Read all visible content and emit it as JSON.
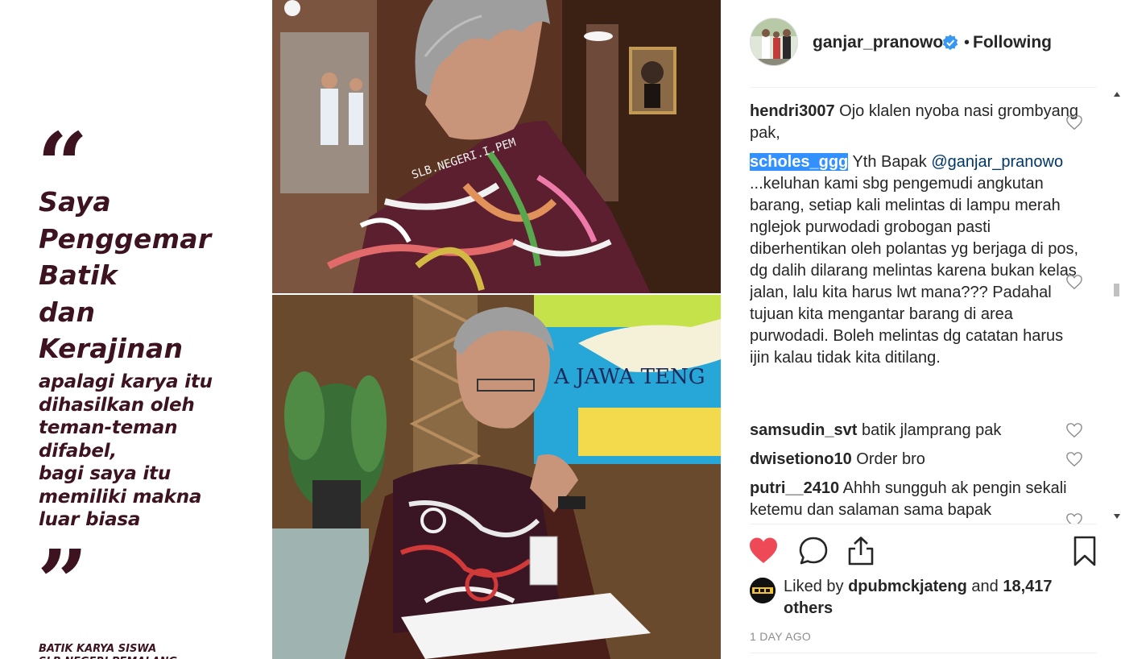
{
  "post_image": {
    "quote_text": "Saya\nPenggemar\nBatik\ndan\nKerajinan",
    "sub_text": "apalagi karya itu\ndihasilkan oleh\nteman-teman\ndifabel,\nbagi saya itu\nmemiliki makna\nluar biasa",
    "caption_credit": "BATIK KARYA SISWA\nSLB NEGERI PEMALANG",
    "shirt_text": "SLB.NEGERI.I.PEM",
    "map_text": "A JAWA TENG",
    "quote_open": "“",
    "quote_close": "”"
  },
  "header": {
    "username": "ganjar_pranowo",
    "separator": "•",
    "follow_status": "Following",
    "verified_color": "#3897f0"
  },
  "comments": [
    {
      "user": "hendri3007",
      "text": "Ojo klalen nyoba nasi grombyang pak,"
    },
    {
      "user": "scholes_ggg",
      "text_before_mention": "Yth Bapak",
      "mention": "@ganjar_pranowo",
      "text": "...keluhan kami sbg pengemudi angkutan barang, setiap kali melintas di lampu merah nglejok purwodadi grobogan pasti diberhentikan oleh polantas yg berjaga di pos, dg dalih dilarang melintas karena bukan kelas jalan, lalu kita harus lwt mana??? Padahal tujuan kita mengantar barang di area purwodadi. Boleh melintas dg catatan harus ijin kalau tidak kita ditilang."
    },
    {
      "user": "samsudin_svt",
      "text": "batik jlamprang pak"
    },
    {
      "user": "dwisetiono10",
      "text": "Order bro"
    },
    {
      "user": "putri__2410",
      "text": "Ahhh sungguh ak pengin sekali ketemu dan salaman sama bapak"
    }
  ],
  "likes": {
    "prefix": "Liked by",
    "user": "dpubmckjateng",
    "and": "and",
    "count": "18,417 others"
  },
  "timestamp": "1 DAY AGO",
  "icons": {
    "like": "heart-filled-icon",
    "comment": "comment-icon",
    "share": "share-icon",
    "save": "bookmark-icon"
  },
  "colors": {
    "like_red": "#ed4956",
    "quote_maroon": "#3d1320",
    "mention_blue": "#00376b",
    "selection_blue": "#3390ff"
  }
}
